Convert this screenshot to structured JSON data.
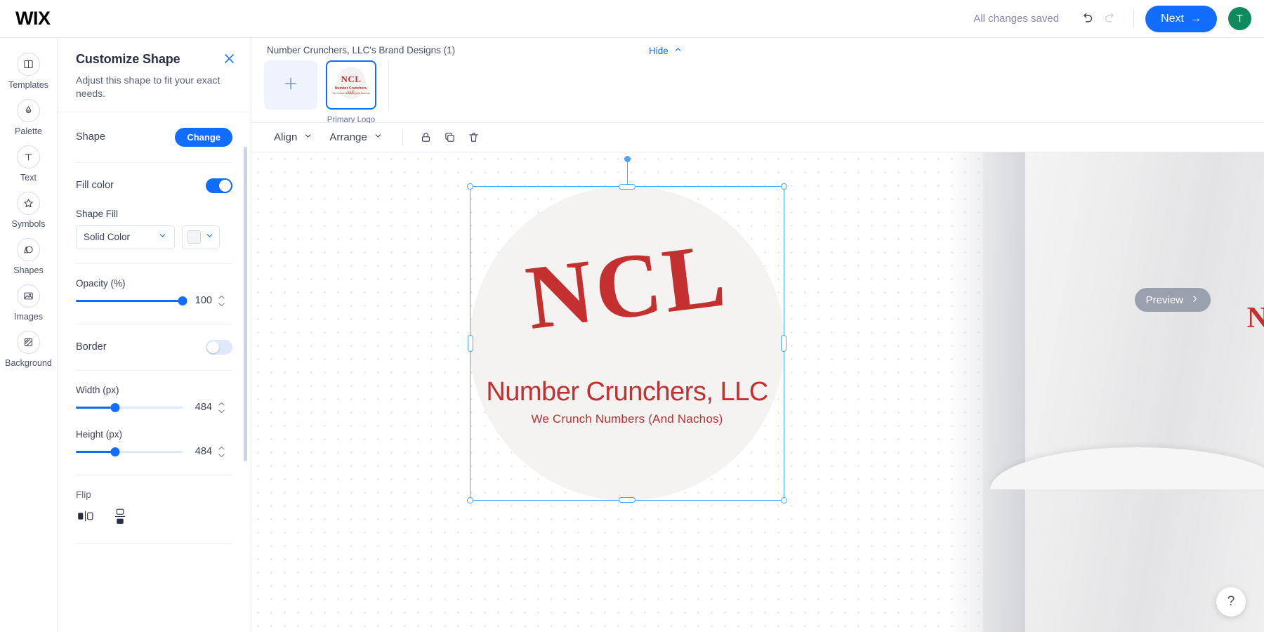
{
  "topbar": {
    "brand": "WIX",
    "save_status": "All changes saved",
    "undo_icon": "undo-icon",
    "redo_icon": "redo-icon",
    "next_label": "Next",
    "next_arrow": "→",
    "avatar_initial": "T",
    "accent_color": "#116dff",
    "avatar_color": "#0f8a5f"
  },
  "rail": {
    "items": [
      {
        "label": "Templates",
        "icon": "templates-icon"
      },
      {
        "label": "Palette",
        "icon": "palette-icon"
      },
      {
        "label": "Text",
        "icon": "text-icon"
      },
      {
        "label": "Symbols",
        "icon": "symbols-icon"
      },
      {
        "label": "Shapes",
        "icon": "shapes-icon"
      },
      {
        "label": "Images",
        "icon": "images-icon"
      },
      {
        "label": "Background",
        "icon": "background-icon"
      }
    ]
  },
  "panel": {
    "title": "Customize Shape",
    "subtitle": "Adjust this shape to fit your exact needs.",
    "close_icon": "close-icon",
    "shape_label": "Shape",
    "change_label": "Change",
    "fill_color_label": "Fill color",
    "fill_color_on": true,
    "shape_fill_label": "Shape Fill",
    "shape_fill_value": "Solid Color",
    "shape_fill_swatch": "#f3f4f7",
    "opacity_label": "Opacity (%)",
    "opacity_value": "100",
    "opacity_percent": 100,
    "border_label": "Border",
    "border_on": false,
    "width_label": "Width (px)",
    "width_value": "484",
    "width_percent": 37,
    "height_label": "Height (px)",
    "height_value": "484",
    "height_percent": 37,
    "flip_label": "Flip",
    "flip_horizontal_icon": "flip-horizontal-icon",
    "flip_vertical_icon": "flip-vertical-icon"
  },
  "strip": {
    "title": "Number Crunchers, LLC's Brand Designs (1)",
    "hide_label": "Hide",
    "hide_chevron": "chevron-up-icon",
    "add_icon": "plus-icon",
    "thumb_caption": "Primary Logo"
  },
  "toolbar": {
    "align_label": "Align",
    "arrange_label": "Arrange",
    "lock_icon": "lock-icon",
    "duplicate_icon": "duplicate-icon",
    "delete_icon": "trash-icon"
  },
  "canvas": {
    "logo_monogram": "NCL",
    "logo_name": "Number Crunchers, LLC",
    "logo_tagline": "We Crunch Numbers (And Nachos)",
    "logo_color": "#c3302f",
    "logo_bg": "#f5f3f1",
    "selection_color": "#49a5ff",
    "preview_label": "Preview",
    "preview_arrow": "›",
    "help_label": "?",
    "mockup_letter": "N"
  }
}
